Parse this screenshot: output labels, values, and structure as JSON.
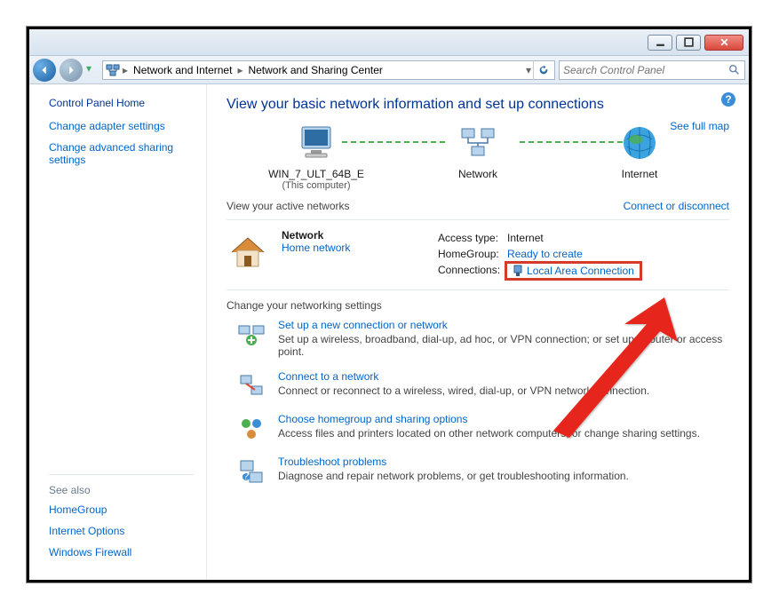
{
  "window": {
    "btn_min": "minimize",
    "btn_max": "maximize",
    "btn_close": "close"
  },
  "breadcrumb": {
    "level1": "Network and Internet",
    "level2": "Network and Sharing Center"
  },
  "search": {
    "placeholder": "Search Control Panel"
  },
  "side": {
    "home": "Control Panel Home",
    "l1": "Change adapter settings",
    "l2": "Change advanced sharing settings",
    "see_also": "See also",
    "s1": "HomeGroup",
    "s2": "Internet Options",
    "s3": "Windows Firewall"
  },
  "heading": "View your basic network information and set up connections",
  "fullmap": "See full map",
  "map": {
    "pc": "WIN_7_ULT_64B_E",
    "pc_sub": "(This computer)",
    "net": "Network",
    "inet": "Internet"
  },
  "active": {
    "header": "View your active networks",
    "connect_link": "Connect or disconnect",
    "net_name": "Network",
    "net_cat": "Home network",
    "k1": "Access type:",
    "v1": "Internet",
    "k2": "HomeGroup:",
    "v2": "Ready to create",
    "k3": "Connections:",
    "v3": "Local Area Connection"
  },
  "settings": {
    "header": "Change your networking settings",
    "t1": "Set up a new connection or network",
    "d1": "Set up a wireless, broadband, dial-up, ad hoc, or VPN connection; or set up a router or access point.",
    "t2": "Connect to a network",
    "d2": "Connect or reconnect to a wireless, wired, dial-up, or VPN network connection.",
    "t3": "Choose homegroup and sharing options",
    "d3": "Access files and printers located on other network computers, or change sharing settings.",
    "t4": "Troubleshoot problems",
    "d4": "Diagnose and repair network problems, or get troubleshooting information."
  }
}
